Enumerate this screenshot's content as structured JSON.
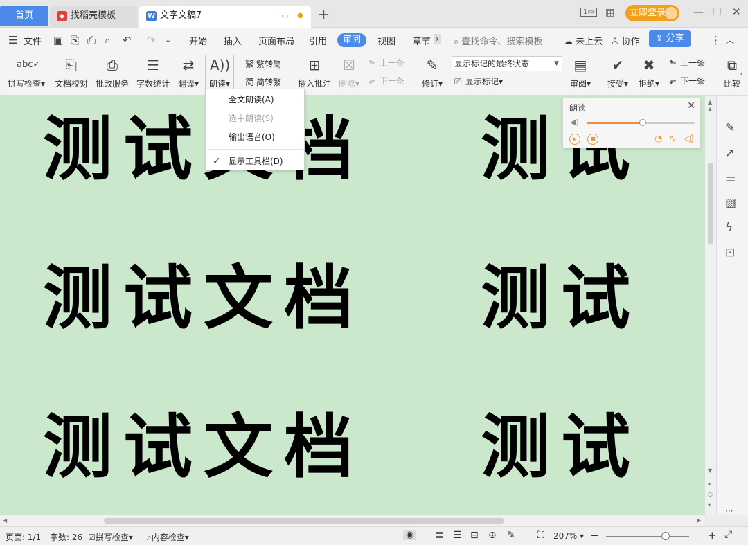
{
  "titlebar": {
    "tabs": [
      {
        "label": "首页"
      },
      {
        "label": "找稻壳模板"
      },
      {
        "label": "文字文稿7"
      }
    ],
    "login_label": "立即登录"
  },
  "menubar": {
    "file_label": "文件",
    "items": [
      "开始",
      "插入",
      "页面布局",
      "引用",
      "审阅",
      "视图",
      "章节"
    ],
    "active_item": "审阅",
    "search_placeholder": "查找命令、搜索模板",
    "cloud_label": "未上云",
    "collab_label": "协作",
    "share_label": "分享"
  },
  "ribbon": {
    "spell_check": "拼写检查",
    "doc_proofread": "文档校对",
    "review_service": "批改服务",
    "word_count": "字数统计",
    "translate": "翻译",
    "read_aloud": "朗读",
    "trad_to_simp": "繁转简",
    "simp_to_trad": "简转繁",
    "insert_comment": "插入批注",
    "delete": "删除",
    "prev_comment": "上一条",
    "next_comment": "下一条",
    "track_changes": "修订",
    "markup_mode": "显示标记的最终状态",
    "show_markup": "显示标记",
    "review_pane": "审阅",
    "accept": "接受",
    "reject": "拒绝",
    "prev_change": "上一条",
    "next_change": "下一条",
    "compare": "比较"
  },
  "document": {
    "lines": [
      "测试文档",
      "测试文档",
      "测试文档"
    ],
    "right_col": [
      "测试",
      "测试",
      "测试"
    ]
  },
  "read_aloud_menu": {
    "items": [
      {
        "label": "全文朗读(A)",
        "enabled": true,
        "checked": false
      },
      {
        "label": "选中朗读(S)",
        "enabled": false,
        "checked": false
      },
      {
        "label": "输出语音(O)",
        "enabled": true,
        "checked": false
      },
      {
        "label": "显示工具栏(D)",
        "enabled": true,
        "checked": true
      }
    ]
  },
  "read_aloud_panel": {
    "title": "朗读",
    "volume_level": 0.52
  },
  "statusbar": {
    "page": "页面: 1/1",
    "word_count": "字数: 26",
    "spell_check": "拼写检查",
    "content_check": "内容检查",
    "zoom": "207%"
  },
  "colors": {
    "accent": "#4b8ae8",
    "login": "#f0a01c",
    "canvas_bg": "#cce8cc",
    "panel_accent": "#f08c3c"
  }
}
